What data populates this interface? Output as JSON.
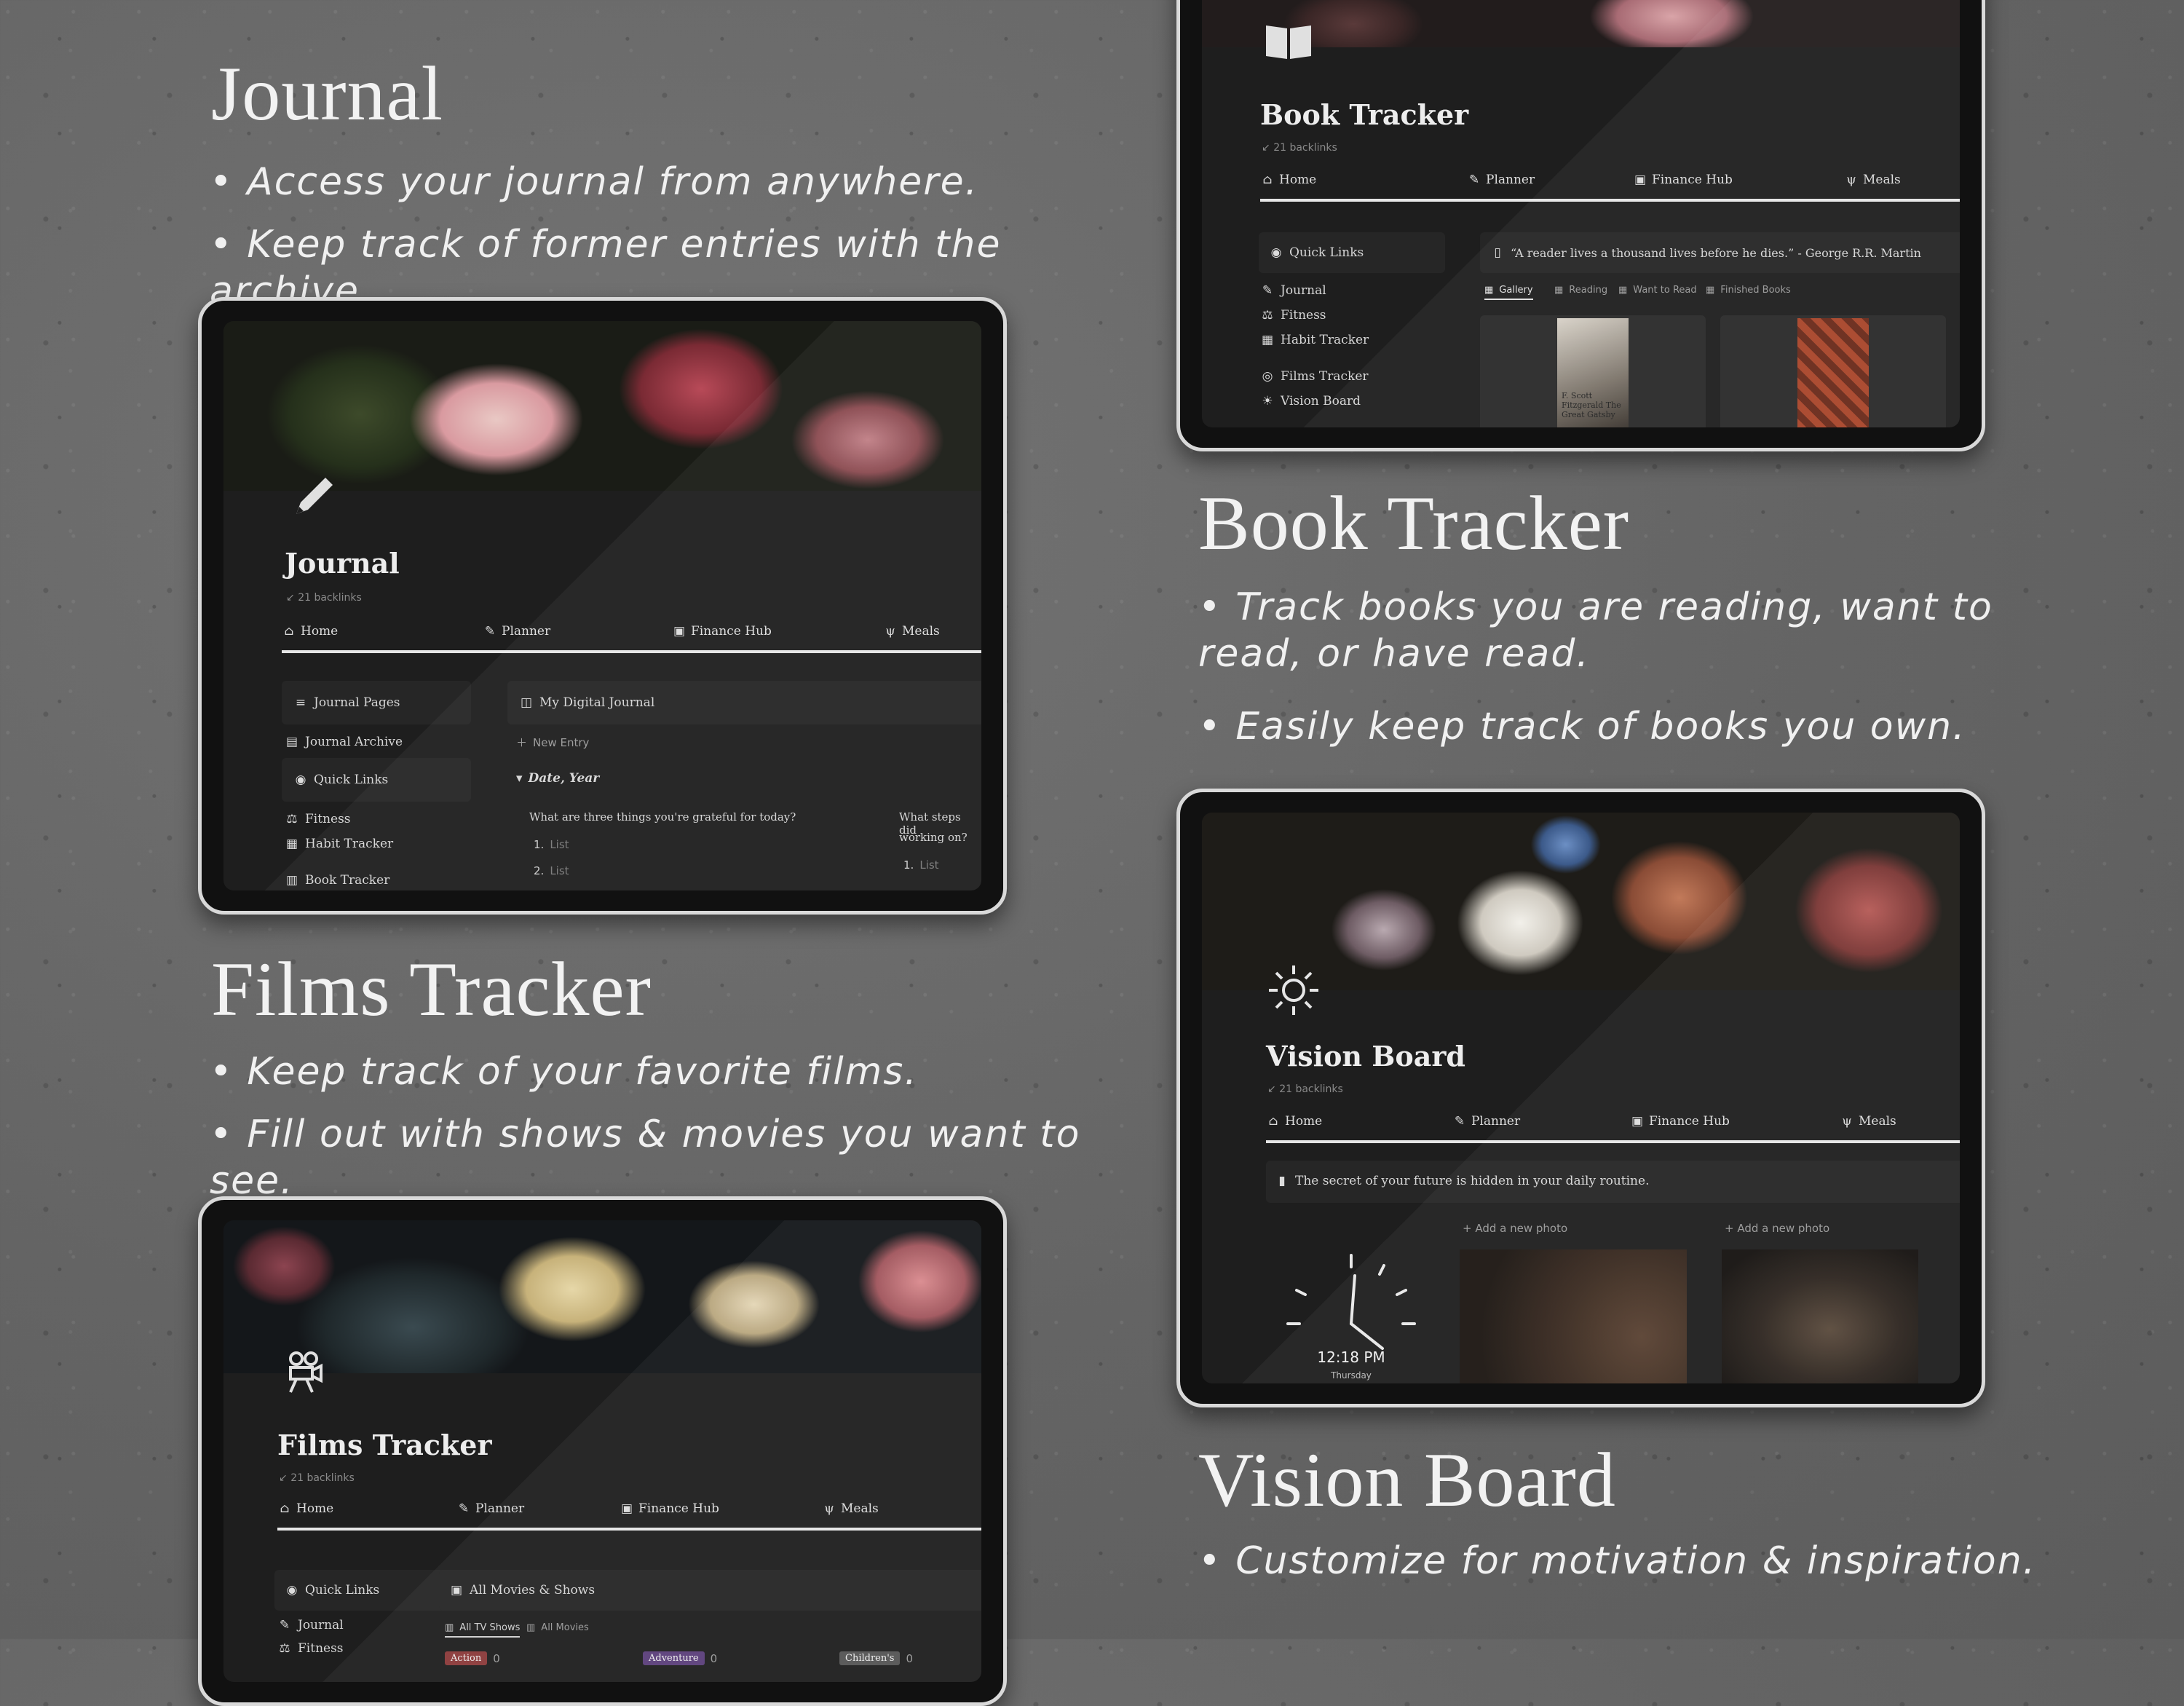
{
  "sections": {
    "journal": {
      "heading": "Journal",
      "bullets": [
        "Access your journal from anywhere.",
        "Keep track of former entries with the archive."
      ]
    },
    "films": {
      "heading": "Films Tracker",
      "bullets": [
        "Keep track of your favorite films.",
        "Fill out with shows & movies you want to see."
      ]
    },
    "books": {
      "heading": "Book Tracker",
      "bullets": [
        "Track books you are reading, want to read, or have read.",
        "Easily keep track of books you own."
      ]
    },
    "vision": {
      "heading": "Vision Board",
      "bullets": [
        "Customize for motivation & inspiration."
      ]
    }
  },
  "nav": {
    "home": "Home",
    "planner": "Planner",
    "finance": "Finance Hub",
    "meals": "Meals"
  },
  "backlinks": "21 backlinks",
  "icons": {
    "home": "house-icon",
    "planner": "pen-icon",
    "finance": "money-icon",
    "meals": "utensils-icon",
    "journal_page": "pencil-icon",
    "book_page": "open-book-icon",
    "films_page": "movie-camera-icon",
    "vision_page": "sun-icon"
  },
  "journal_screen": {
    "title": "Journal",
    "side": {
      "pages": "Journal Pages",
      "archive": "Journal Archive",
      "quick_links": "Quick Links",
      "fitness": "Fitness",
      "habit": "Habit Tracker",
      "book": "Book Tracker"
    },
    "main": {
      "db_title": "My Digital Journal",
      "new_entry": "New Entry",
      "group": "Date, Year",
      "q1": "What are three things you're grateful for today?",
      "q2_line1": "What steps did",
      "q2_line2": "working on?",
      "list": "List",
      "n1": "1.",
      "n2": "2."
    }
  },
  "book_screen": {
    "title": "Book Tracker",
    "side": {
      "quick_links": "Quick Links",
      "journal": "Journal",
      "fitness": "Fitness",
      "habit": "Habit Tracker",
      "films": "Films Tracker",
      "vision": "Vision Board"
    },
    "quote": "“A reader lives a thousand lives before he dies.” - George R.R. Martin",
    "tabs": [
      "Gallery",
      "Reading",
      "Want to Read",
      "Finished Books"
    ],
    "cover_text": "F. Scott Fitzgerald The Great Gatsby"
  },
  "films_screen": {
    "title": "Films Tracker",
    "side": {
      "quick_links": "Quick Links",
      "journal": "Journal",
      "fitness": "Fitness"
    },
    "db_title": "All Movies & Shows",
    "tabs": [
      "All TV Shows",
      "All Movies"
    ],
    "groups": [
      {
        "label": "Action",
        "count": "0",
        "color": "#8b3a3a"
      },
      {
        "label": "Adventure",
        "count": "0",
        "color": "#5b3f7a"
      },
      {
        "label": "Children's",
        "count": "0",
        "color": "#555555"
      }
    ]
  },
  "vision_screen": {
    "title": "Vision Board",
    "callout": "The secret of your future is hidden in your daily routine.",
    "add_photo": "+ Add a new photo",
    "clock_time": "12:18 PM",
    "clock_day": "Thursday"
  },
  "colors": {
    "background": "#6b6b6b",
    "screen": "#1e1e1e",
    "bezel": "#d9d9d9"
  }
}
